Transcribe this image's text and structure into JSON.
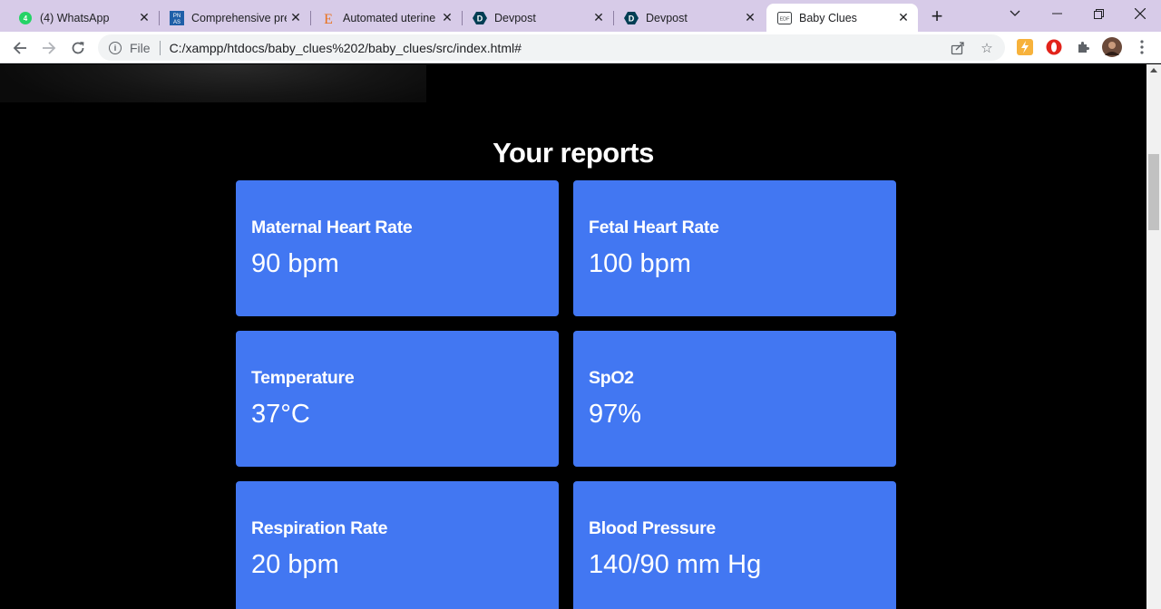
{
  "browser": {
    "tabs": [
      {
        "title": "(4) WhatsApp",
        "icon": "whatsapp-icon"
      },
      {
        "title": "Comprehensive pre",
        "icon": "pnas-icon"
      },
      {
        "title": "Automated uterine",
        "icon": "elsevier-icon"
      },
      {
        "title": "Devpost",
        "icon": "devpost-icon"
      },
      {
        "title": "Devpost",
        "icon": "devpost-icon"
      },
      {
        "title": "Baby Clues",
        "icon": "document-icon",
        "active": true
      }
    ],
    "new_tab": "+",
    "address": {
      "scheme_label": "File",
      "url": "C:/xampp/htdocs/baby_clues%202/baby_clues/src/index.html#"
    },
    "colors": {
      "tabstrip": "#d7cbe8",
      "toolbar": "#ffffff"
    }
  },
  "page": {
    "section_title": "Your reports",
    "card_color": "#4277f2",
    "reports": [
      {
        "label": "Maternal Heart Rate",
        "value": "90 bpm"
      },
      {
        "label": "Fetal Heart Rate",
        "value": "100 bpm"
      },
      {
        "label": "Temperature",
        "value": "37°C"
      },
      {
        "label": "SpO2",
        "value": "97%"
      },
      {
        "label": "Respiration Rate",
        "value": "20 bpm"
      },
      {
        "label": "Blood Pressure",
        "value": "140/90 mm Hg"
      }
    ]
  }
}
